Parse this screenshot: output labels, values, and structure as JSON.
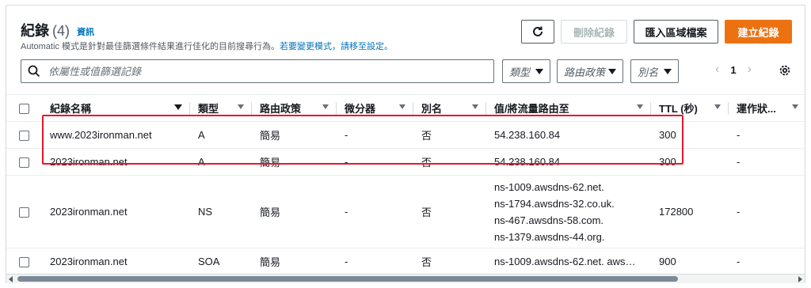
{
  "header": {
    "title": "紀錄",
    "count": "(4)",
    "info_link": "資訊",
    "description_prefix": "Automatic 模式是針對最佳篩選條件結果進行佳化的目前搜尋行為。",
    "description_link": "若要變更模式，請移至設定。"
  },
  "buttons": {
    "refresh_icon": "refresh-icon",
    "delete_label": "刪除紀錄",
    "import_label": "匯入區域檔案",
    "create_label": "建立紀錄"
  },
  "search": {
    "placeholder": "依屬性或值篩選記錄"
  },
  "filters": {
    "type_label": "類型",
    "routing_label": "路由政策",
    "alias_label": "別名"
  },
  "pagination": {
    "page": "1",
    "prev_icon": "chevron-left-icon",
    "next_icon": "chevron-right-icon"
  },
  "table": {
    "columns": [
      "紀錄名稱",
      "類型",
      "路由政策",
      "微分器",
      "別名",
      "值/將流量路由至",
      "TTL (秒)",
      "運作狀..."
    ],
    "rows": [
      {
        "name": "www.2023ironman.net",
        "type": "A",
        "routing": "簡易",
        "differentiator": "-",
        "alias": "否",
        "value": [
          "54.238.160.84"
        ],
        "ttl": "300",
        "health": "-"
      },
      {
        "name": "2023ironman.net",
        "type": "A",
        "routing": "簡易",
        "differentiator": "-",
        "alias": "否",
        "value": [
          "54.238.160.84"
        ],
        "ttl": "300",
        "health": "-"
      },
      {
        "name": "2023ironman.net",
        "type": "NS",
        "routing": "簡易",
        "differentiator": "-",
        "alias": "否",
        "value": [
          "ns-1009.awsdns-62.net.",
          "ns-1794.awsdns-32.co.uk.",
          "ns-467.awsdns-58.com.",
          "ns-1379.awsdns-44.org."
        ],
        "ttl": "172800",
        "health": "-"
      },
      {
        "name": "2023ironman.net",
        "type": "SOA",
        "routing": "簡易",
        "differentiator": "-",
        "alias": "否",
        "value": [
          "ns-1009.awsdns-62.net. aws…"
        ],
        "ttl": "900",
        "health": "-"
      }
    ]
  },
  "colors": {
    "accent": "#ec7211",
    "link": "#0073bb",
    "highlight": "#e3182d"
  }
}
